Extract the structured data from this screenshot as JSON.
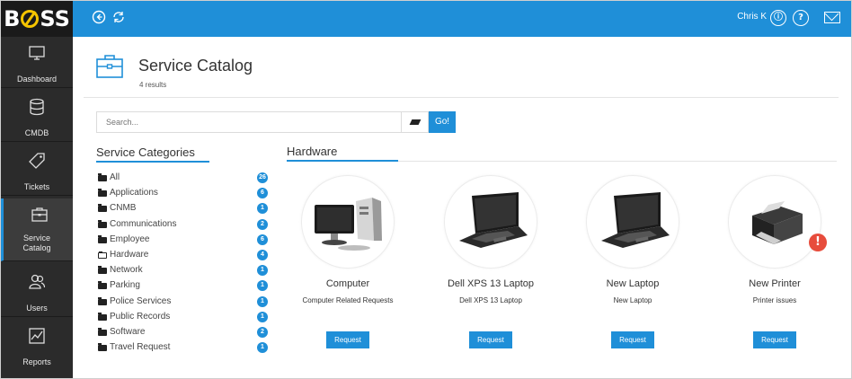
{
  "app": {
    "logo": "BOSS"
  },
  "topbar": {
    "user_name": "Chris K"
  },
  "sidebar": {
    "items": [
      {
        "label": "Dashboard"
      },
      {
        "label": "CMDB"
      },
      {
        "label": "Tickets"
      },
      {
        "label": "Service Catalog",
        "active": true
      },
      {
        "label": "Users"
      },
      {
        "label": "Reports"
      }
    ]
  },
  "header": {
    "title": "Service Catalog",
    "subtitle": "4 results"
  },
  "search": {
    "placeholder": "Search...",
    "go_label": "Go!"
  },
  "categories": {
    "title": "Service Categories",
    "items": [
      {
        "label": "All",
        "count": "26"
      },
      {
        "label": "Applications",
        "count": "6"
      },
      {
        "label": "CNMB",
        "count": "1"
      },
      {
        "label": "Communications",
        "count": "2"
      },
      {
        "label": "Employee",
        "count": "6"
      },
      {
        "label": "Hardware",
        "count": "4"
      },
      {
        "label": "Network",
        "count": "1"
      },
      {
        "label": "Parking",
        "count": "1"
      },
      {
        "label": "Police Services",
        "count": "1"
      },
      {
        "label": "Public Records",
        "count": "1"
      },
      {
        "label": "Software",
        "count": "2"
      },
      {
        "label": "Travel Request",
        "count": "1"
      }
    ]
  },
  "hardware": {
    "title": "Hardware",
    "cards": [
      {
        "name": "Computer",
        "description": "Computer Related Requests",
        "button": "Request",
        "icon": "computer-image"
      },
      {
        "name": "Dell XPS 13 Laptop",
        "description": "Dell XPS 13 Laptop",
        "button": "Request",
        "icon": "laptop-image"
      },
      {
        "name": "New Laptop",
        "description": "New Laptop",
        "button": "Request",
        "icon": "laptop-image"
      },
      {
        "name": "New Printer",
        "description": "Printer issues",
        "button": "Request",
        "icon": "printer-image"
      }
    ]
  },
  "colors": {
    "accent": "#1f8fd8",
    "sidebar": "#2b2b2b",
    "alert": "#e74c3c"
  }
}
